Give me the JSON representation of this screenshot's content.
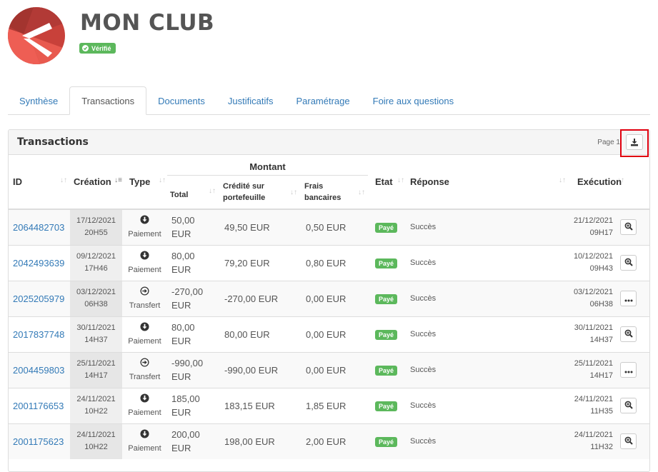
{
  "header": {
    "club_name": "MON CLUB",
    "verified_label": "Vérifié"
  },
  "tabs": [
    {
      "label": "Synthèse",
      "active": false
    },
    {
      "label": "Transactions",
      "active": true
    },
    {
      "label": "Documents",
      "active": false
    },
    {
      "label": "Justificatifs",
      "active": false
    },
    {
      "label": "Paramétrage",
      "active": false
    },
    {
      "label": "Foire aux questions",
      "active": false
    }
  ],
  "panel": {
    "title": "Transactions",
    "page_label": "Page 1",
    "download_icon": "download-icon"
  },
  "table": {
    "headers": {
      "id": "ID",
      "creation": "Création",
      "type": "Type",
      "montant": "Montant",
      "total": "Total",
      "credited_1": "Crédité sur",
      "credited_2": "portefeuille",
      "fees_1": "Frais",
      "fees_2": "bancaires",
      "etat": "Etat",
      "reponse": "Réponse",
      "execution": "Exécution"
    },
    "rows": [
      {
        "id": "2064482703",
        "created_date": "17/12/2021",
        "created_time": "20H55",
        "type": "Paiement",
        "type_icon": "arrow-down-circle-icon",
        "total_1": "50,00",
        "total_2": "EUR",
        "credited": "49,50 EUR",
        "fees": "0,50 EUR",
        "status": "Payé",
        "response": "Succès",
        "exec_date": "21/12/2021",
        "exec_time": "09H17",
        "action_icon": "zoom-in-icon"
      },
      {
        "id": "2042493639",
        "created_date": "09/12/2021",
        "created_time": "17H46",
        "type": "Paiement",
        "type_icon": "arrow-down-circle-icon",
        "total_1": "80,00",
        "total_2": "EUR",
        "credited": "79,20 EUR",
        "fees": "0,80 EUR",
        "status": "Payé",
        "response": "Succès",
        "exec_date": "10/12/2021",
        "exec_time": "09H43",
        "action_icon": "zoom-in-icon"
      },
      {
        "id": "2025205979",
        "created_date": "03/12/2021",
        "created_time": "06H38",
        "type": "Transfert",
        "type_icon": "arrow-right-circle-icon",
        "total_1": "-270,00",
        "total_2": "EUR",
        "credited": "-270,00 EUR",
        "fees": "0,00 EUR",
        "status": "Payé",
        "response": "Succès",
        "exec_date": "03/12/2021",
        "exec_time": "06H38",
        "action_icon": "more-icon"
      },
      {
        "id": "2017837748",
        "created_date": "30/11/2021",
        "created_time": "14H37",
        "type": "Paiement",
        "type_icon": "arrow-down-circle-icon",
        "total_1": "80,00",
        "total_2": "EUR",
        "credited": "80,00 EUR",
        "fees": "0,00 EUR",
        "status": "Payé",
        "response": "Succès",
        "exec_date": "30/11/2021",
        "exec_time": "14H37",
        "action_icon": "zoom-in-icon"
      },
      {
        "id": "2004459803",
        "created_date": "25/11/2021",
        "created_time": "14H17",
        "type": "Transfert",
        "type_icon": "arrow-right-circle-icon",
        "total_1": "-990,00",
        "total_2": "EUR",
        "credited": "-990,00 EUR",
        "fees": "0,00 EUR",
        "status": "Payé",
        "response": "Succès",
        "exec_date": "25/11/2021",
        "exec_time": "14H17",
        "action_icon": "more-icon"
      },
      {
        "id": "2001176653",
        "created_date": "24/11/2021",
        "created_time": "10H22",
        "type": "Paiement",
        "type_icon": "arrow-down-circle-icon",
        "total_1": "185,00",
        "total_2": "EUR",
        "credited": "183,15 EUR",
        "fees": "1,85 EUR",
        "status": "Payé",
        "response": "Succès",
        "exec_date": "24/11/2021",
        "exec_time": "11H35",
        "action_icon": "zoom-in-icon"
      },
      {
        "id": "2001175623",
        "created_date": "24/11/2021",
        "created_time": "10H22",
        "type": "Paiement",
        "type_icon": "arrow-down-circle-icon",
        "total_1": "200,00",
        "total_2": "EUR",
        "credited": "198,00 EUR",
        "fees": "2,00 EUR",
        "status": "Payé",
        "response": "Succès",
        "exec_date": "24/11/2021",
        "exec_time": "11H32",
        "action_icon": "zoom-in-icon"
      }
    ]
  },
  "colors": {
    "brand_red": "#d9443a",
    "link_blue": "#337ab7",
    "success_green": "#5cb85c",
    "highlight_red": "#e0000f"
  }
}
